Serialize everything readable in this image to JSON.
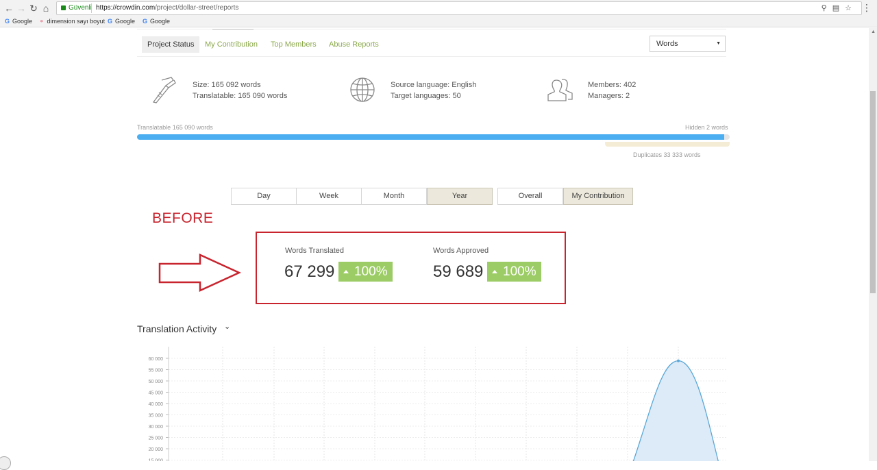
{
  "browser": {
    "back_icon": "arrow-left-icon",
    "forward_icon": "arrow-right-icon",
    "reload_icon": "reload-icon",
    "home_icon": "home-icon",
    "secure_label": "Güvenli",
    "url_host": "https://crowdin.com",
    "url_path": "/project/dollar-street/reports",
    "bookmarks": [
      {
        "label": "Google"
      },
      {
        "label": "dimension sayı boyut"
      },
      {
        "label": "Google"
      },
      {
        "label": "Google"
      }
    ]
  },
  "tabs": [
    {
      "label": "Project Status",
      "active": true
    },
    {
      "label": "My Contribution",
      "active": false
    },
    {
      "label": "Top Members",
      "active": false
    },
    {
      "label": "Abuse Reports",
      "active": false
    }
  ],
  "units_select": {
    "value": "Words"
  },
  "stats": {
    "size": "Size: 165 092 words",
    "translatable": "Translatable: 165 090 words",
    "source_language": "Source language: English",
    "target_languages": "Target languages: 50",
    "members": "Members: 402",
    "managers": "Managers: 2"
  },
  "progress": {
    "translatable_label": "Translatable 165 090 words",
    "hidden_label": "Hidden 2 words",
    "duplicates_label": "Duplicates 33 333 words",
    "translatable_fraction": 0.99
  },
  "periods": [
    {
      "label": "Day",
      "selected": false
    },
    {
      "label": "Week",
      "selected": false
    },
    {
      "label": "Month",
      "selected": false
    },
    {
      "label": "Year",
      "selected": true
    }
  ],
  "scope": [
    {
      "label": "Overall",
      "selected": false
    },
    {
      "label": "My Contribution",
      "selected": true
    }
  ],
  "annotation": {
    "before": "BEFORE"
  },
  "kpis": [
    {
      "label": "Words Translated",
      "value": "67 299",
      "change": "100%"
    },
    {
      "label": "Words Approved",
      "value": "59 689",
      "change": "100%"
    }
  ],
  "activity": {
    "title": "Translation Activity"
  },
  "chart_data": {
    "type": "area",
    "y_ticks": [
      "60 000",
      "55 000",
      "50 000",
      "45 000",
      "40 000",
      "35 000",
      "30 000",
      "25 000",
      "20 000",
      "15 000"
    ],
    "ylim": [
      15000,
      60000
    ],
    "peak_value": 58900,
    "color": "#5aa7d8"
  }
}
